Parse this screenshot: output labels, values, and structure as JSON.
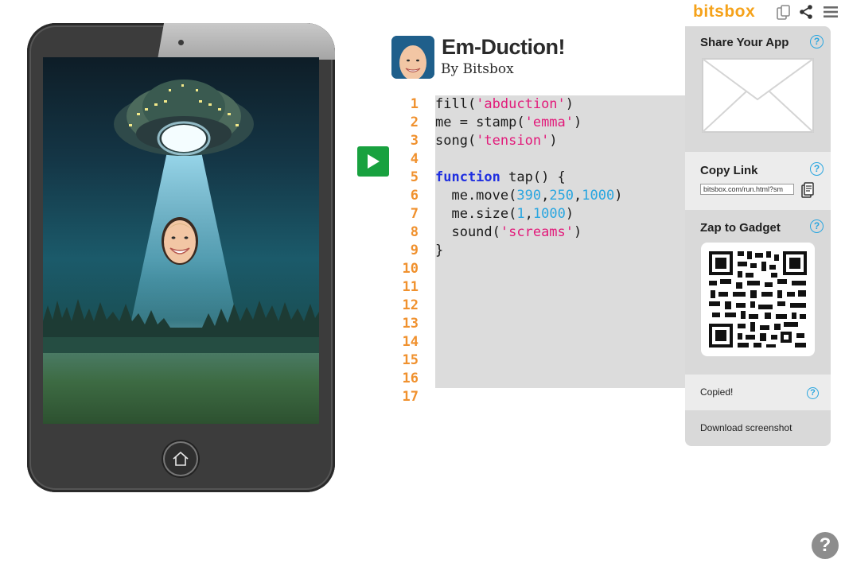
{
  "app": {
    "title": "Em-Duction!",
    "author": "By Bitsbox"
  },
  "brand": {
    "logo_text": "bitsbox",
    "accent": "#f5a21a",
    "run_color": "#18a13f"
  },
  "toolbar": {
    "icons": [
      "tablet-icon",
      "share-icon",
      "menu-icon"
    ]
  },
  "editor": {
    "line_numbers": [
      "1",
      "2",
      "3",
      "4",
      "5",
      "6",
      "7",
      "8",
      "9",
      "10",
      "11",
      "12",
      "13",
      "14",
      "15",
      "16",
      "17"
    ],
    "code_lines": [
      [
        {
          "t": "fill("
        },
        {
          "t": "'abduction'",
          "c": "str"
        },
        {
          "t": ")"
        }
      ],
      [
        {
          "t": "me = stamp("
        },
        {
          "t": "'emma'",
          "c": "str"
        },
        {
          "t": ")"
        }
      ],
      [
        {
          "t": "song("
        },
        {
          "t": "'tension'",
          "c": "str"
        },
        {
          "t": ")"
        }
      ],
      [],
      [
        {
          "t": "function",
          "c": "kw"
        },
        {
          "t": " tap() {"
        }
      ],
      [
        {
          "t": "  me.move("
        },
        {
          "t": "390",
          "c": "num"
        },
        {
          "t": ","
        },
        {
          "t": "250",
          "c": "num"
        },
        {
          "t": ","
        },
        {
          "t": "1000",
          "c": "num"
        },
        {
          "t": ")"
        }
      ],
      [
        {
          "t": "  me.size("
        },
        {
          "t": "1",
          "c": "num"
        },
        {
          "t": ","
        },
        {
          "t": "1000",
          "c": "num"
        },
        {
          "t": ")"
        }
      ],
      [
        {
          "t": "  sound("
        },
        {
          "t": "'screams'",
          "c": "str"
        },
        {
          "t": ")"
        }
      ],
      [
        {
          "t": "}"
        }
      ]
    ]
  },
  "share": {
    "share_title": "Share Your App",
    "copy_title": "Copy Link",
    "link_value": "bitsbox.com/run.html?sm",
    "zap_title": "Zap to Gadget",
    "status": "Copied!",
    "download_label": "Download screenshot",
    "help_symbol": "?"
  },
  "help_button": "?"
}
